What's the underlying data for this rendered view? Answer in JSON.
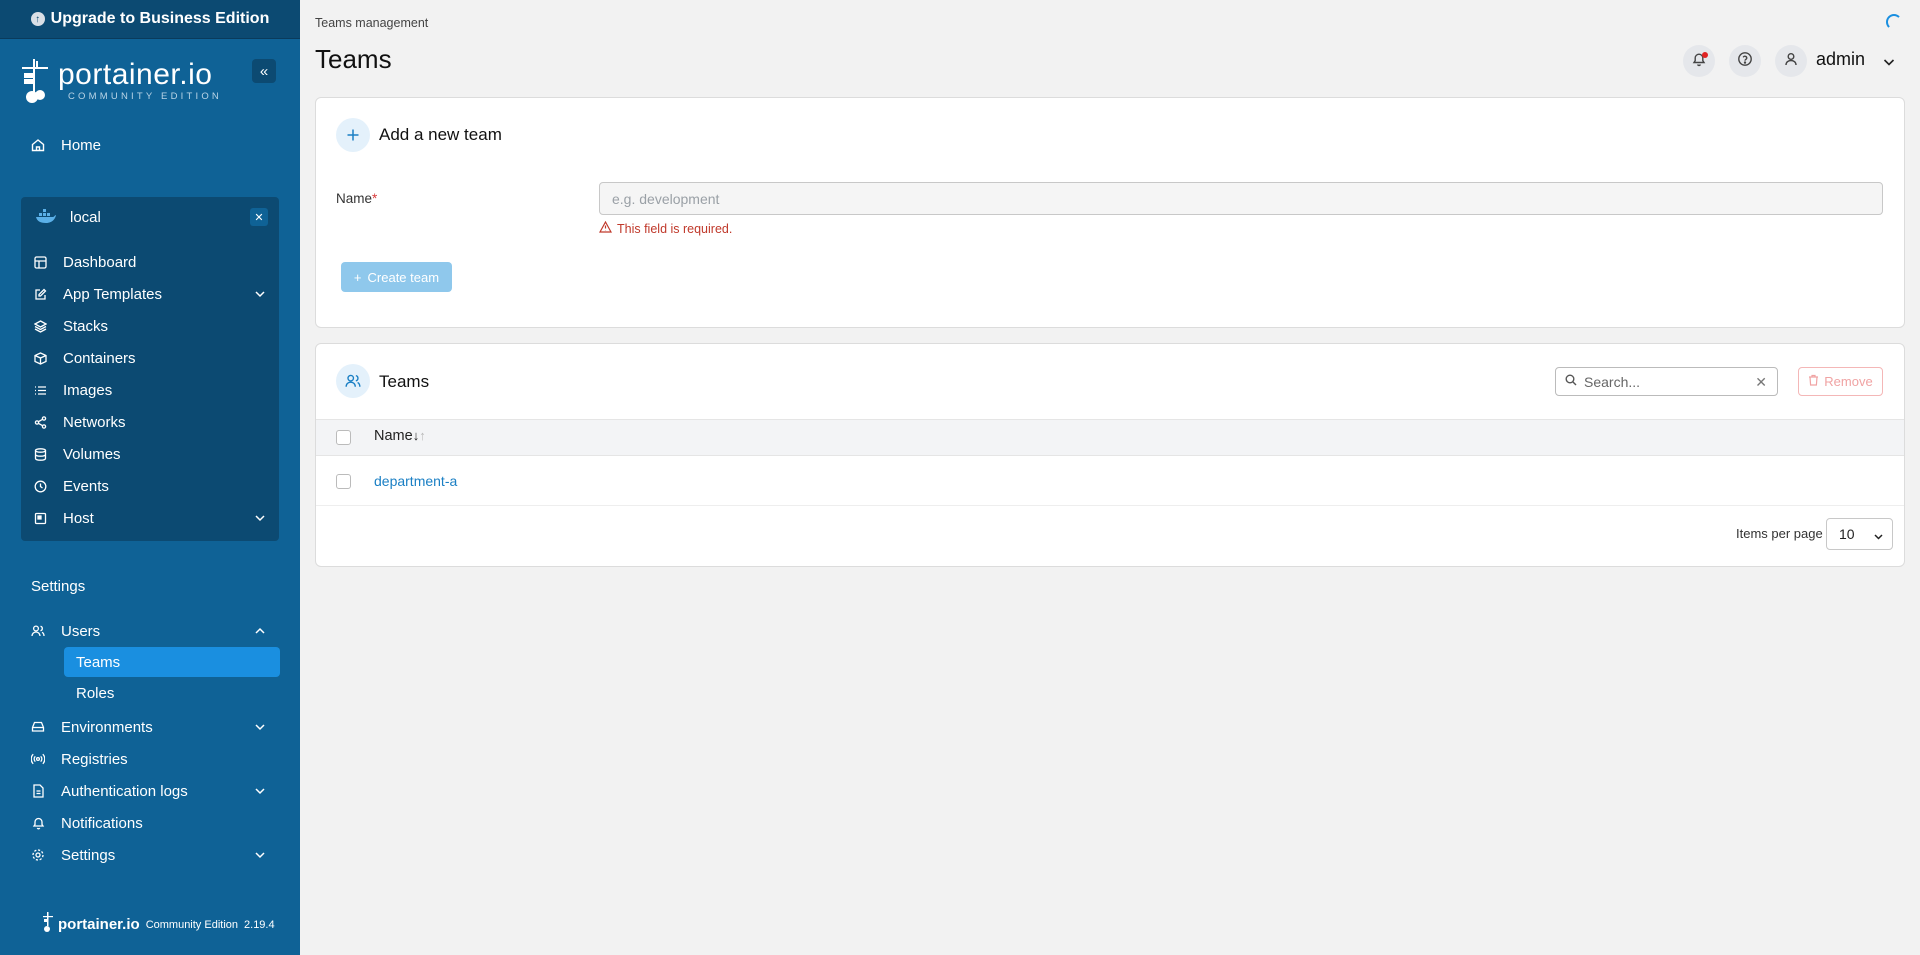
{
  "sidebar": {
    "upgrade_label": "Upgrade to Business Edition",
    "brand_name": "portainer.io",
    "brand_sub": "COMMUNITY EDITION",
    "home": "Home",
    "environment": {
      "name": "local",
      "items": [
        "Dashboard",
        "App Templates",
        "Stacks",
        "Containers",
        "Images",
        "Networks",
        "Volumes",
        "Events",
        "Host"
      ]
    },
    "settings_heading": "Settings",
    "settings_items": {
      "users": "Users",
      "teams": "Teams",
      "roles": "Roles",
      "environments": "Environments",
      "registries": "Registries",
      "auth_logs": "Authentication logs",
      "notifications": "Notifications",
      "settings": "Settings"
    },
    "footer": {
      "name": "portainer.io",
      "edition": "Community Edition",
      "version": "2.19.4"
    }
  },
  "header": {
    "breadcrumb": "Teams management",
    "title": "Teams",
    "user": "admin"
  },
  "add_team": {
    "title": "Add a new team",
    "name_label": "Name",
    "required_mark": "*",
    "placeholder": "e.g. development",
    "error": "This field is required.",
    "create_label": "Create team"
  },
  "teams_table": {
    "title": "Teams",
    "search_placeholder": "Search...",
    "remove_label": "Remove",
    "column_name": "Name",
    "rows": [
      "department-a"
    ],
    "items_per_page_label": "Items per page",
    "items_per_page": "10"
  },
  "colors": {
    "sidebar_bg": "#0f6296",
    "sidebar_dark": "#0c4a72",
    "accent": "#1a8fe0",
    "error": "#c0392b"
  }
}
